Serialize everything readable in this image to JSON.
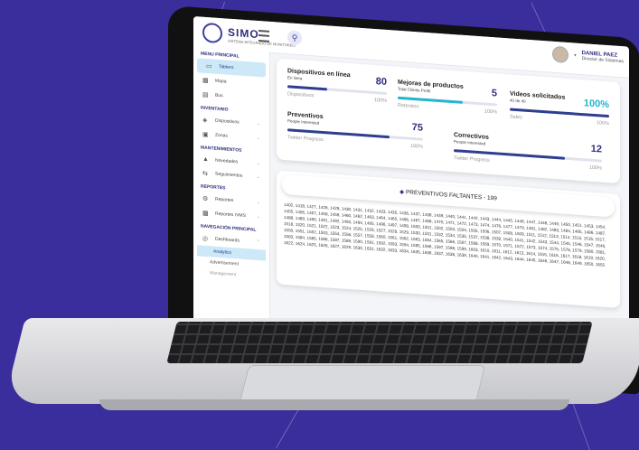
{
  "app": {
    "logo_text": "SIMO",
    "logo_subtitle": "SISTEMA INTEGRADO DE MONITOREO"
  },
  "header": {
    "user_name": "DANIEL PAEZ",
    "user_role": "Director de Sistemas"
  },
  "sidebar": {
    "sections": [
      {
        "title": "MENU PRINCIPAL",
        "items": [
          {
            "label": "Tablero",
            "icon": "monitor-icon",
            "active": true
          },
          {
            "label": "Mapa",
            "icon": "bar-chart-icon"
          },
          {
            "label": "Bus",
            "icon": "bus-icon"
          }
        ]
      },
      {
        "title": "INVENTARIO",
        "items": [
          {
            "label": "Dispositivos",
            "icon": "devices-icon"
          },
          {
            "label": "Zonas",
            "icon": "building-icon"
          }
        ]
      },
      {
        "title": "MANTENIMIENTOS",
        "items": [
          {
            "label": "Novedades",
            "icon": "bell-icon"
          },
          {
            "label": "Seguimientos",
            "icon": "sync-icon"
          }
        ]
      },
      {
        "title": "REPORTES",
        "items": [
          {
            "label": "Reportes",
            "icon": "gear-icon"
          },
          {
            "label": "Reportes IVMS",
            "icon": "chart-icon"
          }
        ]
      },
      {
        "title": "NAVEGACIÓN PRINCIPAL",
        "items": [
          {
            "label": "Dashboards",
            "icon": "dashboard-icon"
          }
        ]
      }
    ],
    "sub_items": [
      {
        "label": "Analytics",
        "active": true
      },
      {
        "label": "Advertisement"
      },
      {
        "label": "Management"
      }
    ]
  },
  "stats": [
    {
      "title": "Dispositivos en línea",
      "subtitle": "En linea",
      "value": "80",
      "bar_label": "Dispositivos",
      "percent_label": "100%",
      "progress": 0.4,
      "color": "#2e3f8f"
    },
    {
      "title": "Mejoras de productos",
      "subtitle": "Total Clients Profit",
      "value": "5",
      "bar_label": "Retention",
      "percent_label": "100%",
      "progress": 0.65,
      "color": "#22b6cf"
    },
    {
      "title": "Videos solicitados",
      "subtitle": "40 de 40",
      "value": "100%",
      "bar_label": "Sales",
      "percent_label": "100%",
      "progress": 1.0,
      "color": "#2e3f8f"
    },
    {
      "title": "Preventivos",
      "subtitle": "People Interested",
      "value": "75",
      "bar_label": "Twitter Progress",
      "percent_label": "100%",
      "progress": 0.75,
      "color": "#2e3f8f"
    },
    {
      "title": "Correctivos",
      "subtitle": "People Interested",
      "value": "12",
      "bar_label": "Twitter Progress",
      "percent_label": "100%",
      "progress": 0.75,
      "color": "#2e3f8f"
    }
  ],
  "pending": {
    "title": "PREVENTIVOS FALTANTES - 199",
    "list": "1402, 1418, 1427, 1428, 1429, 1430, 1431, 1432, 1433, 1435, 1436, 1437, 1438, 1439, 1440, 1441, 1442, 1443, 1444, 1445, 1446, 1447, 1448, 1449, 1450, 1451, 1453, 1454, 1455, 1456, 1457, 1458, 1459, 1460, 1462, 1463, 1464, 1465, 1466, 1467, 1468, 1470, 1471, 1472, 1473, 1474, 1476, 1477, 1479, 1481, 1482, 1483, 1484, 1485, 1486, 1487, 1488, 1489, 1490, 1491, 1492, 1493, 1494, 1495, 1496, 1497, 1499, 1500, 1501, 1502, 1503, 1504, 1505, 1506, 1507, 1508, 1509, 1511, 1512, 1513, 1514, 1515, 1516, 1517, 1518, 1520, 1521, 1522, 1523, 1524, 1525, 1526, 1527, 1528, 1529, 1530, 1531, 1532, 1534, 1535, 1537, 1538, 1539, 1540, 1541, 1542, 1543, 1544, 1545, 1546, 1547, 1549, 1550, 1551, 1552, 1553, 1554, 1556, 1557, 1558, 1560, 1561, 1562, 1563, 1564, 1565, 1566, 1567, 1568, 1569, 1570, 1571, 1572, 1573, 1574, 1575, 1576, 1579, 1580, 1581, 1583, 1584, 1585, 1586, 1587, 1589, 1590, 1591, 1592, 1593, 1594, 1595, 1596, 1597, 1598, 1599, 1603, 1610, 1611, 1612, 1613, 1614, 1615, 1616, 1617, 1618, 1619, 1620, 1622, 1624, 1625, 1626, 1627, 1629, 1630, 1631, 1632, 1633, 1634, 1635, 1636, 1637, 1638, 1639, 1640, 1641, 1642, 1643, 1644, 1645, 1646, 1647, 1648, 1649, 1650, 1655"
  }
}
